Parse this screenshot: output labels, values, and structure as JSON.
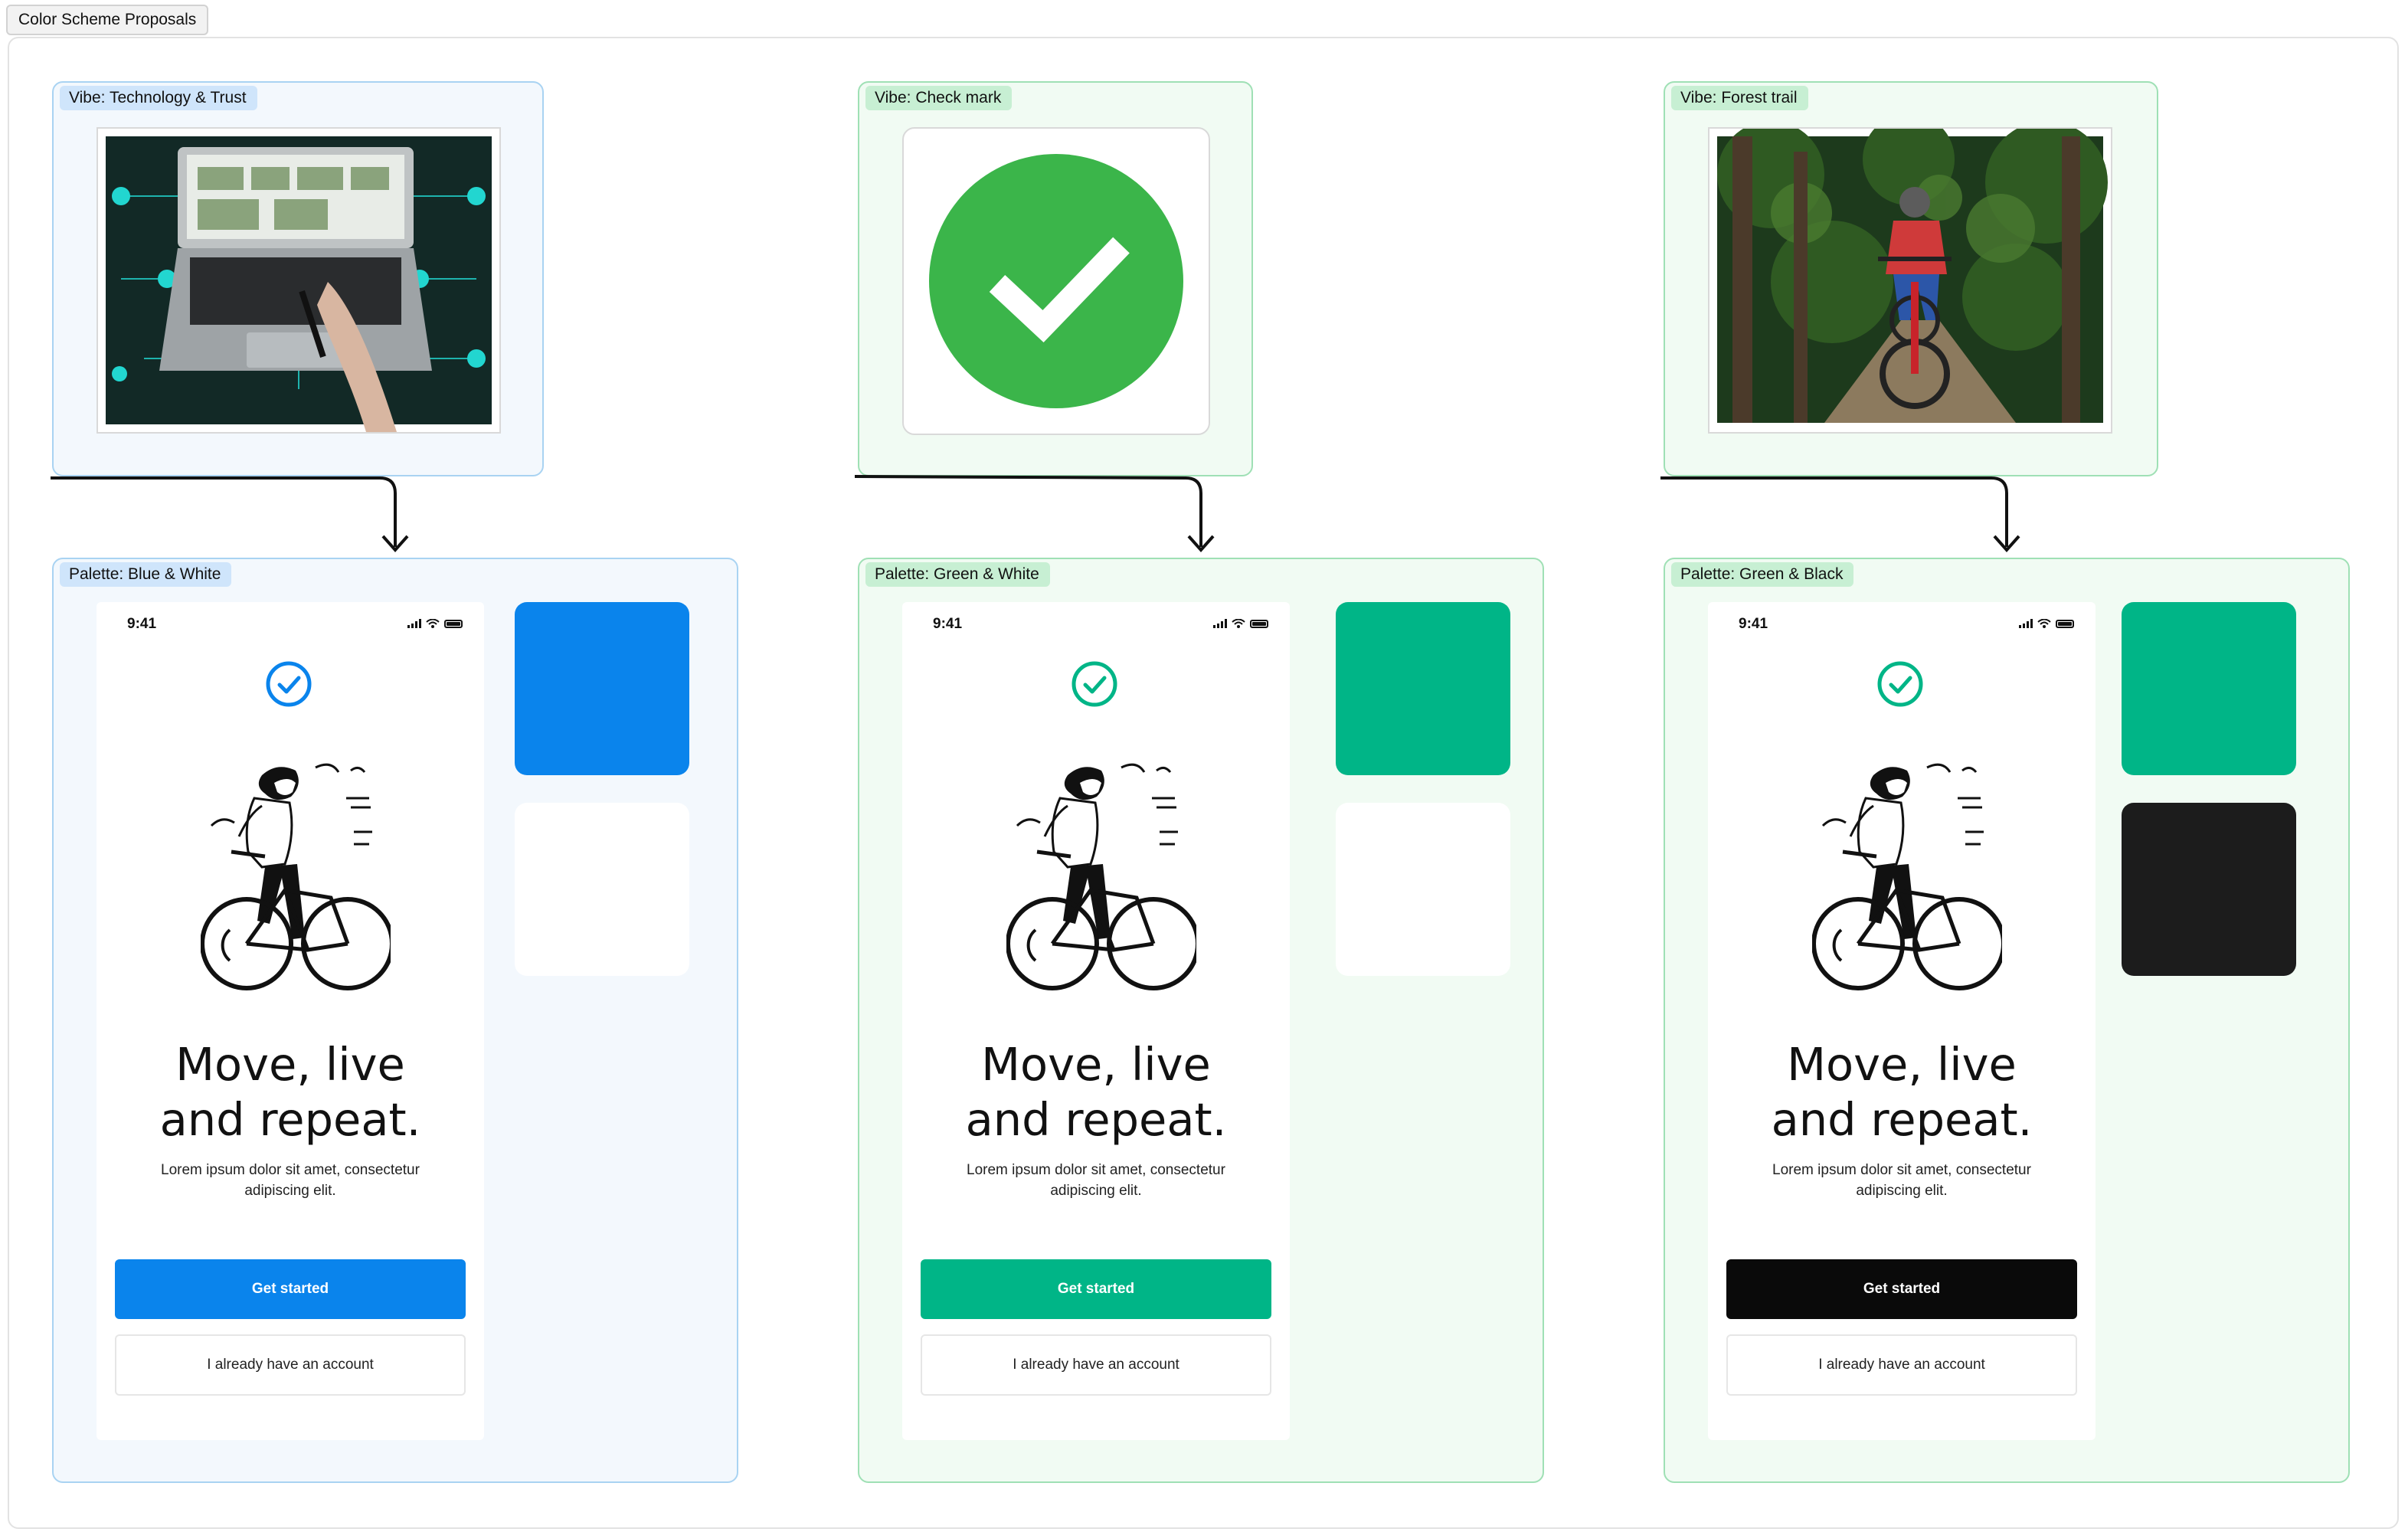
{
  "board": {
    "title": "Color Scheme Proposals"
  },
  "vibes": [
    {
      "label": "Vibe: Technology & Trust",
      "image": "laptop-network-photo"
    },
    {
      "label": "Vibe: Check mark",
      "image": "green-check-circle"
    },
    {
      "label": "Vibe: Forest trail",
      "image": "mountain-biker-forest-photo"
    }
  ],
  "palettes": [
    {
      "label": "Palette:  Blue & White",
      "accent": "#0a84ec",
      "button": "#0a84ec",
      "swatch1": "#0a84ec",
      "swatch2": "#ffffff"
    },
    {
      "label": "Palette:  Green & White",
      "accent": "#00b587",
      "button": "#00b587",
      "swatch1": "#00b587",
      "swatch2": "#ffffff"
    },
    {
      "label": "Palette:  Green & Black",
      "accent": "#00b587",
      "button": "#0a0a0a",
      "swatch1": "#00b587",
      "swatch2": "#1c1c1c"
    }
  ],
  "phone": {
    "time": "9:41",
    "headline_line1": "Move, live",
    "headline_line2": "and repeat.",
    "subtitle_line1": "Lorem ipsum dolor sit amet, consectetur",
    "subtitle_line2": "adipiscing elit.",
    "primary_button": "Get started",
    "secondary_button": "I already have an account"
  }
}
